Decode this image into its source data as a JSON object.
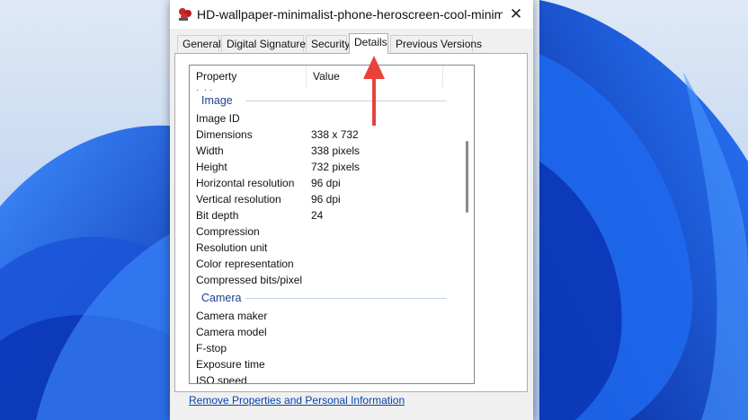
{
  "window": {
    "title": "HD-wallpaper-minimalist-phone-heroscreen-cool-minimalist-...",
    "close_glyph": "✕"
  },
  "tabs": [
    {
      "label": "General",
      "active": false
    },
    {
      "label": "Digital Signatures",
      "active": false
    },
    {
      "label": "Security",
      "active": false
    },
    {
      "label": "Details",
      "active": true
    },
    {
      "label": "Previous Versions",
      "active": false
    }
  ],
  "list": {
    "headers": {
      "property": "Property",
      "value": "Value"
    },
    "groups": [
      {
        "name": "Image",
        "rows": [
          {
            "property": "Image ID",
            "value": ""
          },
          {
            "property": "Dimensions",
            "value": "338 x 732"
          },
          {
            "property": "Width",
            "value": "338 pixels"
          },
          {
            "property": "Height",
            "value": "732 pixels"
          },
          {
            "property": "Horizontal resolution",
            "value": "96 dpi"
          },
          {
            "property": "Vertical resolution",
            "value": "96 dpi"
          },
          {
            "property": "Bit depth",
            "value": "24"
          },
          {
            "property": "Compression",
            "value": ""
          },
          {
            "property": "Resolution unit",
            "value": ""
          },
          {
            "property": "Color representation",
            "value": ""
          },
          {
            "property": "Compressed bits/pixel",
            "value": ""
          }
        ]
      },
      {
        "name": "Camera",
        "rows": [
          {
            "property": "Camera maker",
            "value": ""
          },
          {
            "property": "Camera model",
            "value": ""
          },
          {
            "property": "F-stop",
            "value": ""
          },
          {
            "property": "Exposure time",
            "value": ""
          },
          {
            "property": "ISO speed",
            "value": ""
          }
        ]
      }
    ]
  },
  "footer_link": "Remove Properties and Personal Information",
  "colors": {
    "annotation_arrow": "#e8423b",
    "group_header": "#1e3f94",
    "link": "#0645ad",
    "wallpaper_blue": "#1565e8"
  }
}
